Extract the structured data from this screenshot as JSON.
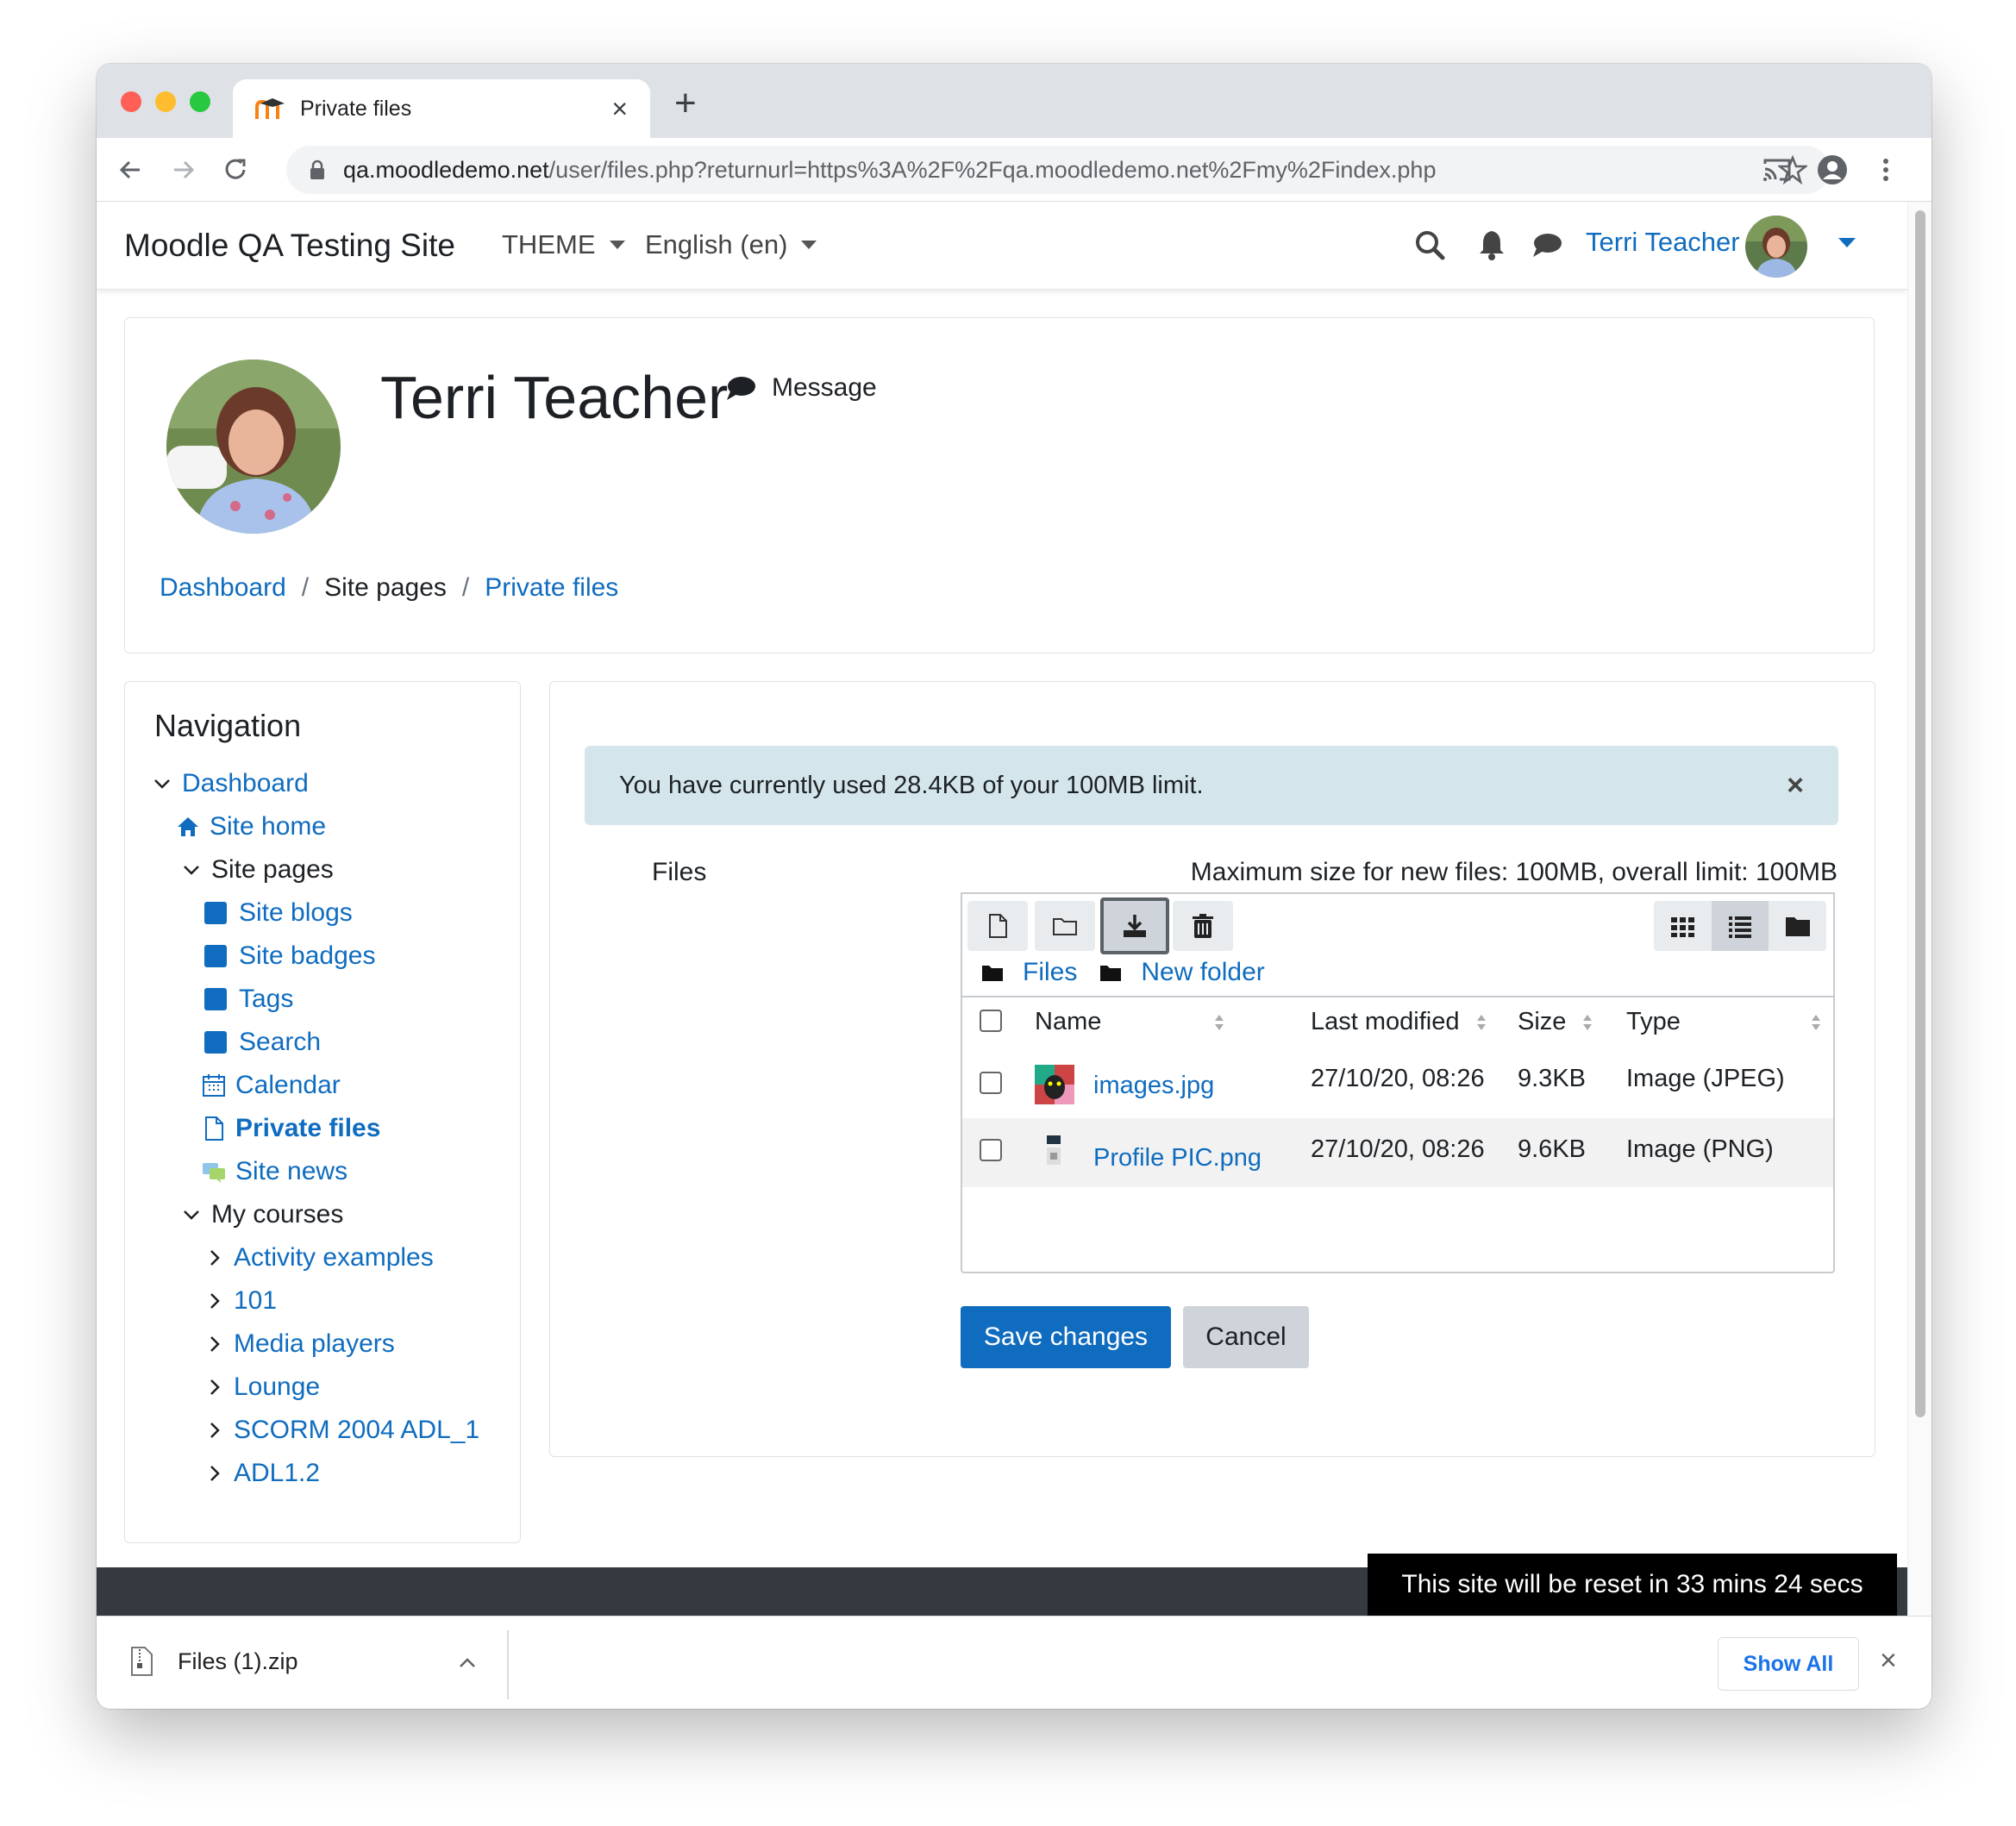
{
  "browser": {
    "tab_title": "Private files",
    "url_host": "qa.moodledemo.net",
    "url_path": "/user/files.php?returnurl=https%3A%2F%2Fqa.moodledemo.net%2Fmy%2Findex.php"
  },
  "navbar": {
    "brand": "Moodle QA Testing Site",
    "theme_label": "THEME",
    "language_label": "English (en)",
    "user_name": "Terri Teacher"
  },
  "profile": {
    "name": "Terri Teacher",
    "message_label": "Message"
  },
  "breadcrumb": {
    "items": [
      "Dashboard",
      "Site pages",
      "Private files"
    ],
    "separator": "/"
  },
  "navigation": {
    "title": "Navigation",
    "dashboard": "Dashboard",
    "site_home": "Site home",
    "site_pages": "Site pages",
    "site_blogs": "Site blogs",
    "site_badges": "Site badges",
    "tags": "Tags",
    "search": "Search",
    "calendar": "Calendar",
    "private_files": "Private files",
    "site_news": "Site news",
    "my_courses": "My courses",
    "courses": [
      "Activity examples",
      "101",
      "Media players",
      "Lounge",
      "SCORM 2004 ADL_1",
      "ADL1.2"
    ]
  },
  "main": {
    "alert": "You have currently used 28.4KB of your 100MB limit.",
    "alert_close": "×",
    "files_label": "Files",
    "max_size": "Maximum size for new files: 100MB, overall limit: 100MB",
    "path": [
      "Files",
      "New folder"
    ],
    "columns": {
      "name": "Name",
      "modified": "Last modified",
      "size": "Size",
      "type": "Type"
    },
    "files": [
      {
        "name": "images.jpg",
        "modified": "27/10/20, 08:26",
        "size": "9.3KB",
        "type": "Image (JPEG)"
      },
      {
        "name": "Profile PIC.png",
        "modified": "27/10/20, 08:26",
        "size": "9.6KB",
        "type": "Image (PNG)"
      }
    ],
    "save_label": "Save changes",
    "cancel_label": "Cancel"
  },
  "reset_banner": "This site will be reset in 33 mins 24 secs",
  "download_shelf": {
    "file_name": "Files (1).zip",
    "show_all": "Show All"
  },
  "colors": {
    "link": "#0f6cbf",
    "alert_bg": "#d4e6ec",
    "primary_button": "#0f6cbf",
    "footer": "#343a40"
  },
  "icons": {
    "toolbar": [
      "add-file-icon",
      "create-folder-icon",
      "download-icon",
      "delete-icon"
    ],
    "views": [
      "icons-view-icon",
      "list-view-icon",
      "tree-view-icon"
    ]
  }
}
